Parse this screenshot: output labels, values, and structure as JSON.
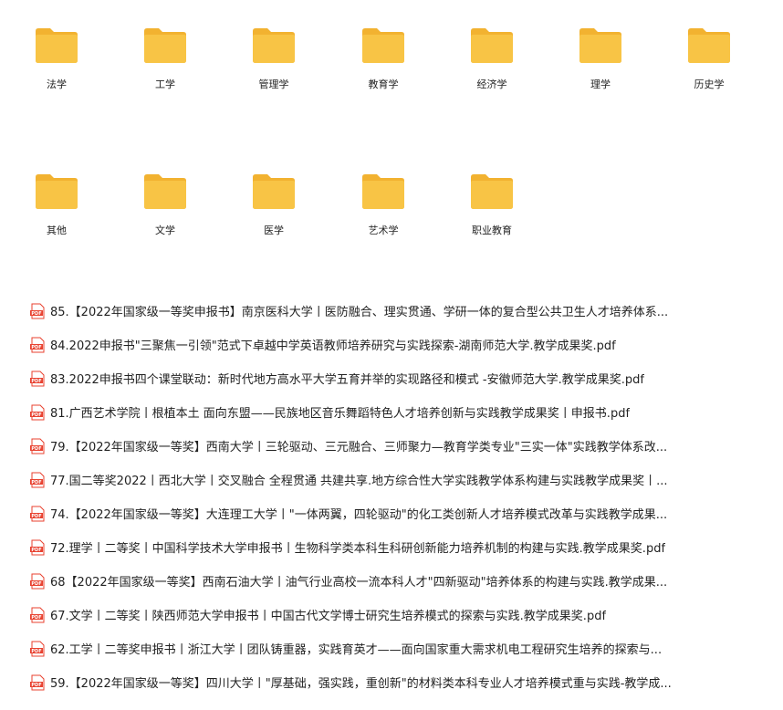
{
  "folders": [
    {
      "label": "法学"
    },
    {
      "label": "工学"
    },
    {
      "label": "管理学"
    },
    {
      "label": "教育学"
    },
    {
      "label": "经济学"
    },
    {
      "label": "理学"
    },
    {
      "label": "历史学"
    },
    {
      "label": "其他"
    },
    {
      "label": "文学"
    },
    {
      "label": "医学"
    },
    {
      "label": "艺术学"
    },
    {
      "label": "职业教育"
    }
  ],
  "files": [
    {
      "name": "85.【2022年国家级一等奖申报书】南京医科大学丨医防融合、理实贯通、学研一体的复合型公共卫生人才培养体系..."
    },
    {
      "name": "84.2022申报书\"三聚焦一引领\"范式下卓越中学英语教师培养研究与实践探索-湖南师范大学.教学成果奖.pdf"
    },
    {
      "name": "83.2022申报书四个课堂联动：新时代地方高水平大学五育并举的实现路径和模式 -安徽师范大学.教学成果奖.pdf"
    },
    {
      "name": "81.广西艺术学院丨根植本土 面向东盟——民族地区音乐舞蹈特色人才培养创新与实践教学成果奖丨申报书.pdf"
    },
    {
      "name": "79.【2022年国家级一等奖】西南大学丨三轮驱动、三元融合、三师聚力—教育学类专业\"三实一体\"实践教学体系改..."
    },
    {
      "name": "77.国二等奖2022丨西北大学丨交叉融合 全程贯通 共建共享.地方综合性大学实践教学体系构建与实践教学成果奖丨..."
    },
    {
      "name": "74.【2022年国家级一等奖】大连理工大学丨\"一体两翼，四轮驱动\"的化工类创新人才培养模式改革与实践教学成果..."
    },
    {
      "name": "72.理学丨二等奖丨中国科学技术大学申报书丨生物科学类本科生科研创新能力培养机制的构建与实践.教学成果奖.pdf"
    },
    {
      "name": "68【2022年国家级一等奖】西南石油大学丨油气行业高校一流本科人才\"四新驱动\"培养体系的构建与实践.教学成果..."
    },
    {
      "name": "67.文学丨二等奖丨陕西师范大学申报书丨中国古代文学博士研究生培养模式的探索与实践.教学成果奖.pdf"
    },
    {
      "name": "62.工学丨二等奖申报书丨浙江大学丨团队铸重器，实践育英才——面向国家重大需求机电工程研究生培养的探索与..."
    },
    {
      "name": "59.【2022年国家级一等奖】四川大学丨\"厚基础，强实践，重创新\"的材料类本科专业人才培养模式重与实践-教学成..."
    }
  ],
  "icons": {
    "folder": "folder-icon",
    "pdf": "pdf-file-icon",
    "pdf_badge_text": "PDF"
  },
  "colors": {
    "folder_body": "#F8C445",
    "folder_back": "#F2B230",
    "pdf_red": "#E8412F"
  }
}
